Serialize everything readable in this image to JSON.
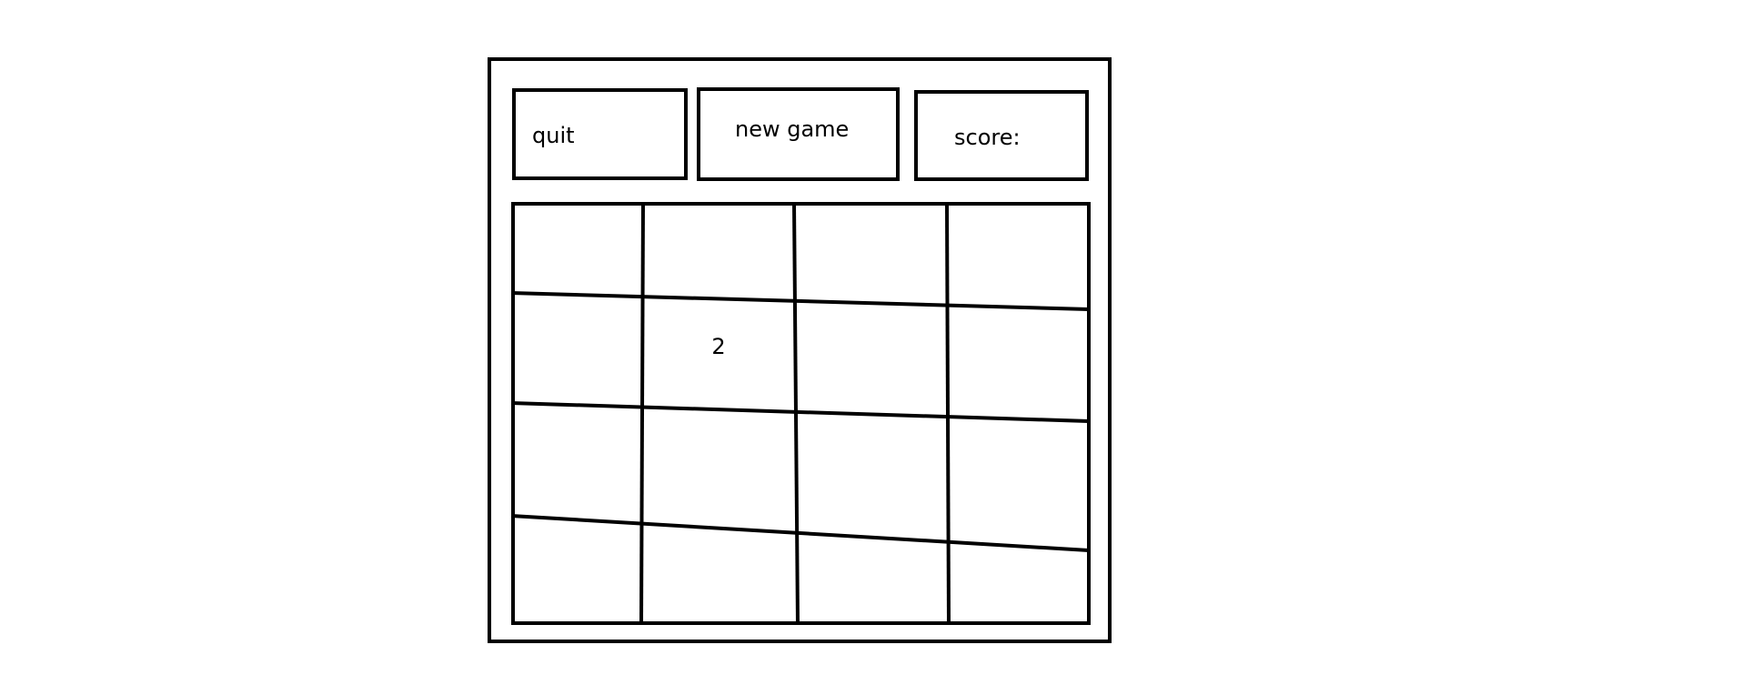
{
  "toolbar": {
    "quit_label": "quit",
    "new_game_label": "new game",
    "score_label": "score:",
    "score_value": ""
  },
  "board": {
    "rows": 4,
    "cols": 4,
    "tiles": [
      [
        "",
        "",
        "",
        ""
      ],
      [
        "",
        "2",
        "",
        ""
      ],
      [
        "",
        "",
        "",
        ""
      ],
      [
        "",
        "",
        "",
        ""
      ]
    ]
  }
}
